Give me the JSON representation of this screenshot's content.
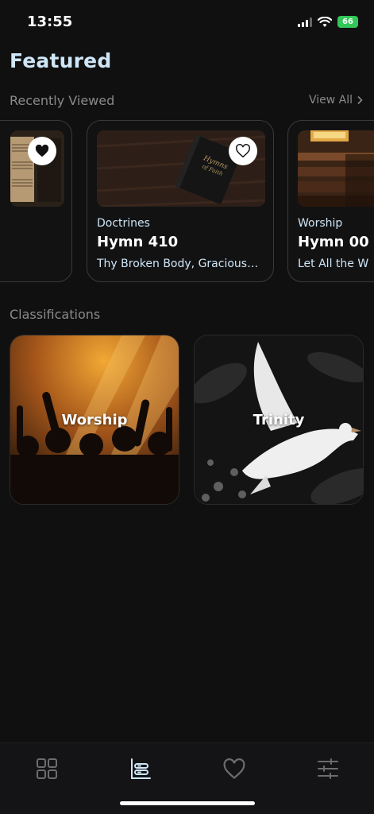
{
  "status": {
    "time": "13:55",
    "battery": "66"
  },
  "header": {
    "title": "Featured"
  },
  "recent": {
    "label": "Recently Viewed",
    "view_all": "View All",
    "cards": [
      {
        "category": "Doctrines",
        "hymn": "Hymn 410",
        "subtitle": "Thy Broken Body, Gracious…"
      },
      {
        "category": "Worship",
        "hymn": "Hymn 00",
        "subtitle": "Let All the W"
      }
    ]
  },
  "classifications": {
    "label": "Classifications",
    "items": [
      {
        "label": "Worship"
      },
      {
        "label": "Trinity"
      }
    ]
  },
  "nav": {
    "items": [
      {
        "icon": "grid-icon"
      },
      {
        "icon": "hymnal-icon",
        "active": true
      },
      {
        "icon": "heart-icon"
      },
      {
        "icon": "sliders-icon"
      }
    ]
  },
  "colors": {
    "accent": "#cfe6f7",
    "background": "#101011",
    "muted": "#8a8a8c"
  }
}
